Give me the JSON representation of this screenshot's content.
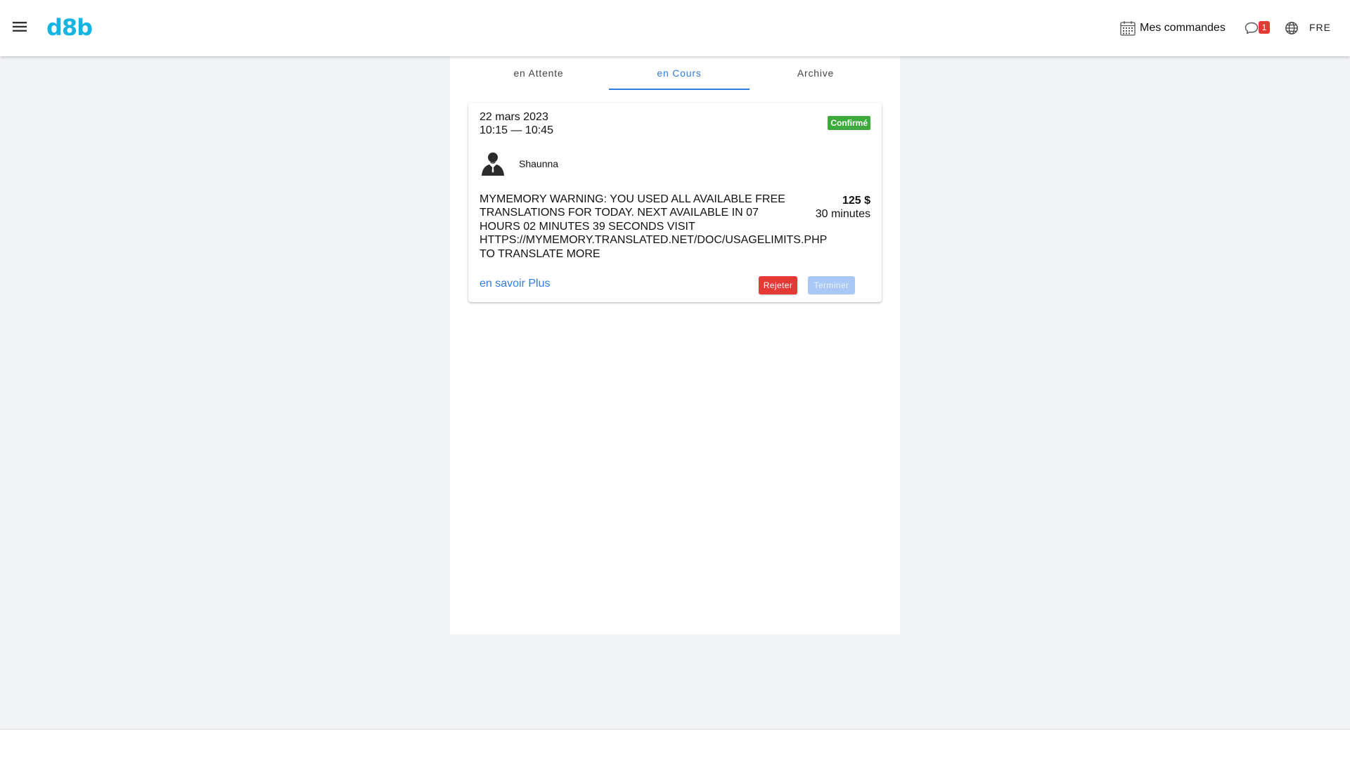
{
  "app": {
    "logo_text": "d8b",
    "brand_color": "#16b4e0"
  },
  "header": {
    "menu_icon": "hamburger-menu-icon",
    "orders_icon": "calendar-icon",
    "orders_label": "Mes commandes",
    "chat_icon": "chat-bubble-icon",
    "chat_badge_count": "1",
    "language_icon": "globe-icon",
    "language_label": "FRE"
  },
  "tabs": [
    {
      "label": "en Attente",
      "active": false
    },
    {
      "label": "en Cours",
      "active": true
    },
    {
      "label": "Archive",
      "active": false
    }
  ],
  "accent_color": "#2f7de1",
  "order": {
    "date": "22 mars 2023",
    "time": "10:15 — 10:45",
    "status": "Confirmé",
    "status_color": "#3caa3c",
    "avatar_icon": "person-avatar-icon",
    "user_name": "Shaunna",
    "description": "MYMEMORY WARNING: YOU USED ALL AVAILABLE FREE TRANSLATIONS FOR TODAY. NEXT AVAILABLE IN 07 HOURS 02 MINUTES 39 SECONDS VISIT HTTPS://MYMEMORY.TRANSLATED.NET/DOC/USAGELIMITS.PHP TO TRANSLATE MORE",
    "price": "125 $",
    "duration": "30 minutes",
    "more_link": "en savoir Plus",
    "reject_label": "Rejeter",
    "reject_color": "#e53935",
    "finish_label": "Terminer",
    "finish_disabled": true
  }
}
